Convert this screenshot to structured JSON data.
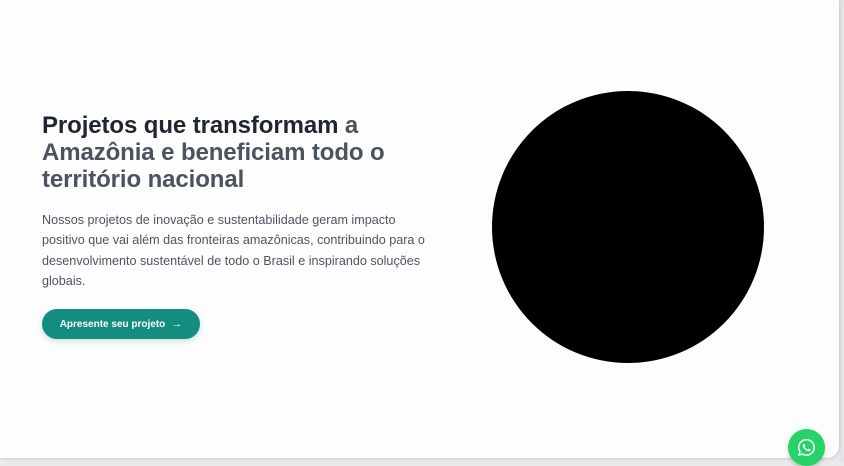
{
  "hero": {
    "title_part1": "Projetos que transformam",
    "title_part2": " a Amazônia e beneficiam todo o território nacional",
    "description": "Nossos projetos de inovação e sustentabilidade geram impacto positivo que vai além das fronteiras amazônicas, contribuindo para o desenvolvimento sustentável de todo o Brasil e inspirando soluções globais.",
    "cta_label": "Apresente seu projeto",
    "cta_icon": "arrow-right-icon",
    "image": "circular-image"
  },
  "floating": {
    "whatsapp_icon": "whatsapp-icon"
  },
  "colors": {
    "accent": "#148c7f",
    "whatsapp": "#25d366",
    "title_dark": "#1f2630",
    "title_muted": "#4a5360"
  }
}
